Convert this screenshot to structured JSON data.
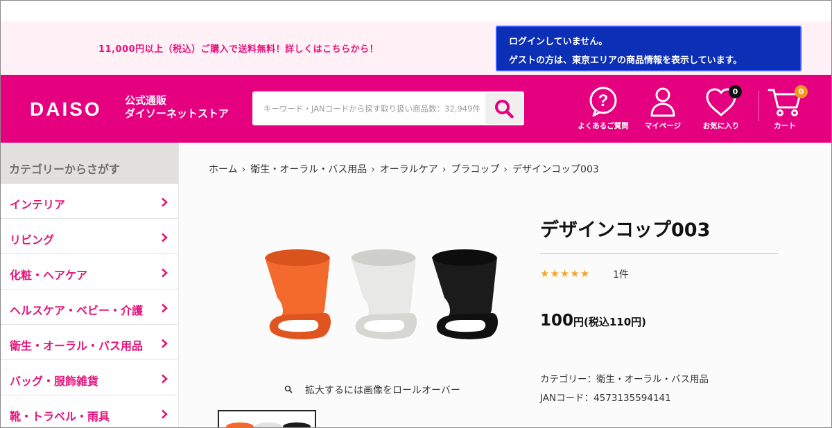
{
  "notice": {
    "shipping": "11,000円以上（税込）ご購入で送料無料！詳しくはこちらから！",
    "login_line1": "ログインしていません。",
    "login_line2": "ゲストの方は、東京エリアの商品情報を表示しています。"
  },
  "header": {
    "logo": "DAISO",
    "logo_sub_line1": "公式通販",
    "logo_sub_line2": "ダイソーネットストア",
    "search_placeholder": "キーワード・JANコードから探す",
    "search_count": "取り扱い商品数：32,949件",
    "nav": {
      "faq": "よくあるご質問",
      "mypage": "マイページ",
      "favorites": "お気に入り",
      "favorites_count": "0",
      "cart": "カート",
      "cart_count": "0"
    },
    "colors": {
      "brand": "#e5007f",
      "login_bg": "#0b2fb5",
      "fav_badge": "#111111",
      "cart_badge": "#f39a1e"
    }
  },
  "sidebar": {
    "heading": "カテゴリーからさがす",
    "items": [
      {
        "label": "インテリア"
      },
      {
        "label": "リビング"
      },
      {
        "label": "化粧・ヘアケア"
      },
      {
        "label": "ヘルスケア・ベビー・介護"
      },
      {
        "label": "衛生・オーラル・バス用品"
      },
      {
        "label": "バッグ・服飾雑貨"
      },
      {
        "label": "靴・トラベル・雨具"
      }
    ]
  },
  "breadcrumb": [
    "ホーム",
    "衛生・オーラル・バス用品",
    "オーラルケア",
    "プラコップ",
    "デザインコップ003"
  ],
  "product": {
    "title": "デザインコップ003",
    "rating": 5,
    "stars": "★★★★★",
    "review_count": "1件",
    "price": "100",
    "price_unit": "円(税込110円)",
    "zoom_hint": "拡大するには画像をロールオーバー",
    "category_line": "カテゴリー：衛生・オーラル・バス用品",
    "jan_line": "JANコード：4573135594141",
    "cup_colors": [
      "#f36a2c",
      "#e8e8e6",
      "#1b1b1b"
    ]
  }
}
